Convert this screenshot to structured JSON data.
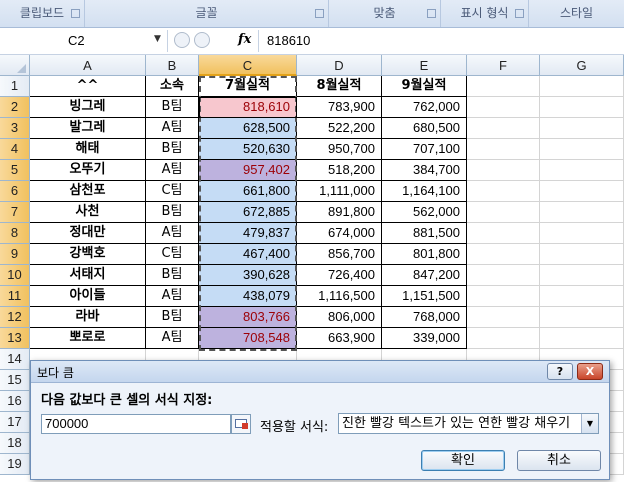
{
  "ribbon": {
    "groups": [
      "클립보드",
      "글꼴",
      "맞춤",
      "표시 형식",
      "스타일"
    ]
  },
  "formula_bar": {
    "name_box": "C2",
    "fx": "fx",
    "value": "818610"
  },
  "columns": [
    "A",
    "B",
    "C",
    "D",
    "E",
    "F",
    "G"
  ],
  "rows": [
    "1",
    "2",
    "3",
    "4",
    "5",
    "6",
    "7",
    "8",
    "9",
    "10",
    "11",
    "12",
    "13",
    "14",
    "15",
    "16",
    "17",
    "18",
    "19"
  ],
  "table": {
    "headers": [
      "^^",
      "소속",
      "7월실적",
      "8월실적",
      "9월실적"
    ],
    "records": [
      {
        "name": "빙그레",
        "team": "B팀",
        "jul": "818,610",
        "aug": "783,900",
        "sep": "762,000",
        "jul_style": "cur"
      },
      {
        "name": "발그레",
        "team": "A팀",
        "jul": "628,500",
        "aug": "522,200",
        "sep": "680,500",
        "jul_style": "sel"
      },
      {
        "name": "해태",
        "team": "B팀",
        "jul": "520,630",
        "aug": "950,700",
        "sep": "707,100",
        "jul_style": "sel"
      },
      {
        "name": "오뚜기",
        "team": "A팀",
        "jul": "957,402",
        "aug": "518,200",
        "sep": "384,700",
        "jul_style": "hl"
      },
      {
        "name": "삼천포",
        "team": "C팀",
        "jul": "661,800",
        "aug": "1,111,000",
        "sep": "1,164,100",
        "jul_style": "sel"
      },
      {
        "name": "사천",
        "team": "B팀",
        "jul": "672,885",
        "aug": "891,800",
        "sep": "562,000",
        "jul_style": "sel"
      },
      {
        "name": "정대만",
        "team": "A팀",
        "jul": "479,837",
        "aug": "674,000",
        "sep": "881,500",
        "jul_style": "sel"
      },
      {
        "name": "강백호",
        "team": "C팀",
        "jul": "467,400",
        "aug": "856,700",
        "sep": "801,800",
        "jul_style": "sel"
      },
      {
        "name": "서태지",
        "team": "B팀",
        "jul": "390,628",
        "aug": "726,400",
        "sep": "847,200",
        "jul_style": "sel"
      },
      {
        "name": "아이들",
        "team": "A팀",
        "jul": "438,079",
        "aug": "1,116,500",
        "sep": "1,151,500",
        "jul_style": "sel"
      },
      {
        "name": "라바",
        "team": "B팀",
        "jul": "803,766",
        "aug": "806,000",
        "sep": "768,000",
        "jul_style": "hl"
      },
      {
        "name": "뽀로로",
        "team": "A팀",
        "jul": "708,548",
        "aug": "663,900",
        "sep": "339,000",
        "jul_style": "hl"
      }
    ]
  },
  "dialog": {
    "title": "보다 큼",
    "help_label": "?",
    "close_label": "X",
    "prompt": "다음 값보다 큰 셀의 서식 지정:",
    "value": "700000",
    "format_label": "적용할 서식:",
    "format_value": "진한 빨강 텍스트가 있는 연한 빨강 채우기",
    "ok_label": "확인",
    "cancel_label": "취소"
  },
  "colors": {
    "highlight_fill": "#bdb2de",
    "highlight_text": "#9c0006",
    "selection_fill": "#c5dcf5",
    "active_header": "#f1c15f"
  }
}
